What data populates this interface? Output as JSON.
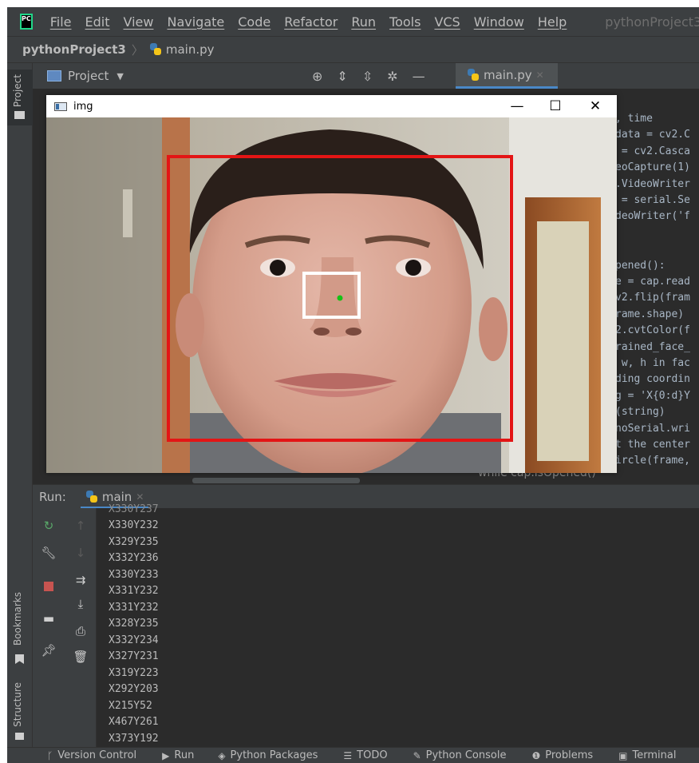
{
  "menubar": {
    "logo_text": "PC",
    "items": [
      "File",
      "Edit",
      "View",
      "Navigate",
      "Code",
      "Refactor",
      "Run",
      "Tools",
      "VCS",
      "Window",
      "Help"
    ],
    "title": "pythonProject3"
  },
  "navbar": {
    "project": "pythonProject3",
    "file": "main.py"
  },
  "sidebar": {
    "project_label": "Project",
    "bookmarks_label": "Bookmarks",
    "structure_label": "Structure"
  },
  "project_panel": {
    "title": "Project"
  },
  "editor": {
    "tab_label": "main.py",
    "code_lines": [
      ", time",
      "data = cv2.C",
      " = cv2.Casca",
      "eoCapture(1)",
      ".VideoWriter",
      " = serial.Se",
      "deoWriter('f",
      "",
      "",
      "pened():",
      "e = cap.read",
      "v2.flip(fram",
      "rame.shape)",
      "2.cvtColor(f",
      "rained_face_",
      " w, h in fac",
      "ding coordin",
      "g = 'X{0:d}Y",
      "(string)",
      "noSerial.wri",
      "t the center",
      "ircle(frame,"
    ],
    "breadcrumb_hint": "while cap.isOpened()"
  },
  "img_window": {
    "title": "img"
  },
  "run_panel": {
    "label": "Run:",
    "tab": "main",
    "console_lines": [
      "X330Y232",
      "X329Y235",
      "X332Y236",
      "X330Y233",
      "X331Y232",
      "X331Y232",
      "X328Y235",
      "X332Y234",
      "X327Y231",
      "X319Y223",
      "X292Y203",
      "X215Y52",
      "X467Y261",
      "X373Y192"
    ]
  },
  "statusbar": {
    "items": [
      "Version Control",
      "Run",
      "Python Packages",
      "TODO",
      "Python Console",
      "Problems",
      "Terminal"
    ]
  },
  "colors": {
    "face_box": "#e31515",
    "nose_box": "#ffffff",
    "center_dot": "#16c116",
    "accent": "#4a88c7"
  }
}
